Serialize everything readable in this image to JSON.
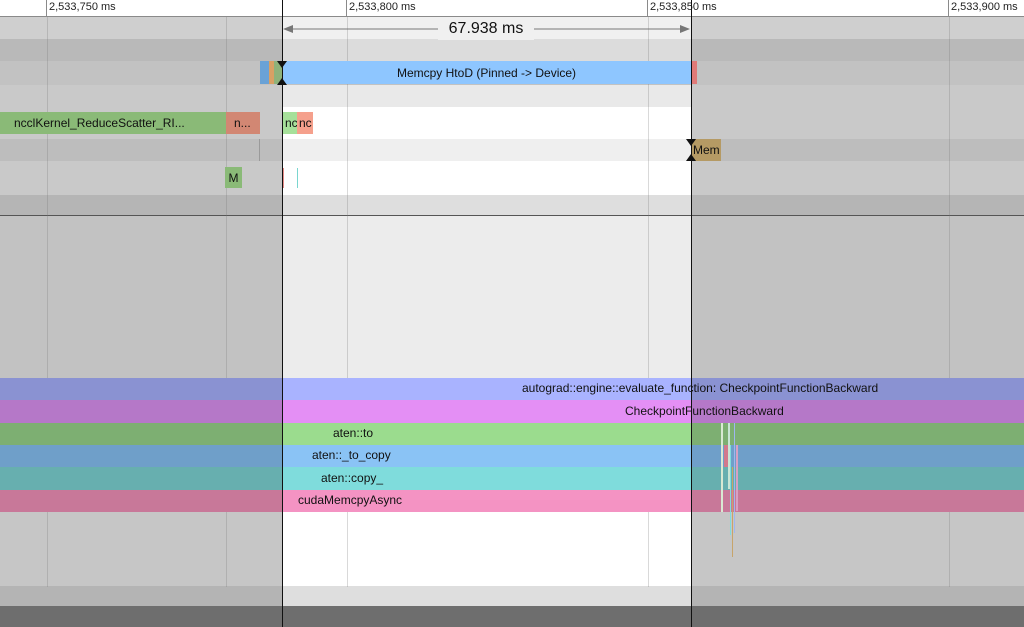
{
  "ruler": {
    "ticks": [
      "2,533,750 ms",
      "2,533,800 ms",
      "2,533,850 ms",
      "2,533,900 ms"
    ]
  },
  "selection": {
    "duration_label": "67.938 ms"
  },
  "tracks": {
    "memcpy_label": "Memcpy HtoD (Pinned -> Device)",
    "nccl_reduce_label": "ncclKernel_ReduceScatter_RI...",
    "nccl_short_label": "n...",
    "nc_label_1": "nc",
    "nc_label_2": "nc",
    "mem_label": "Mem",
    "m_label": "M"
  },
  "cpu": {
    "rows": [
      "autograd::engine::evaluate_function: CheckpointFunctionBackward",
      "CheckpointFunctionBackward",
      "aten::to",
      "aten::_to_copy",
      "aten::copy_",
      "cudaMemcpyAsync"
    ]
  },
  "colors": {
    "memcpy": "#8ec6ff",
    "nccl": "#8aba77",
    "autograd": "#a9b3ff",
    "checkpoint": "#e48ff5",
    "aten_to": "#9bdc8e",
    "to_copy": "#8ac3f5",
    "copy_": "#7fdcdc",
    "cudamemcpy": "#f493c3"
  }
}
